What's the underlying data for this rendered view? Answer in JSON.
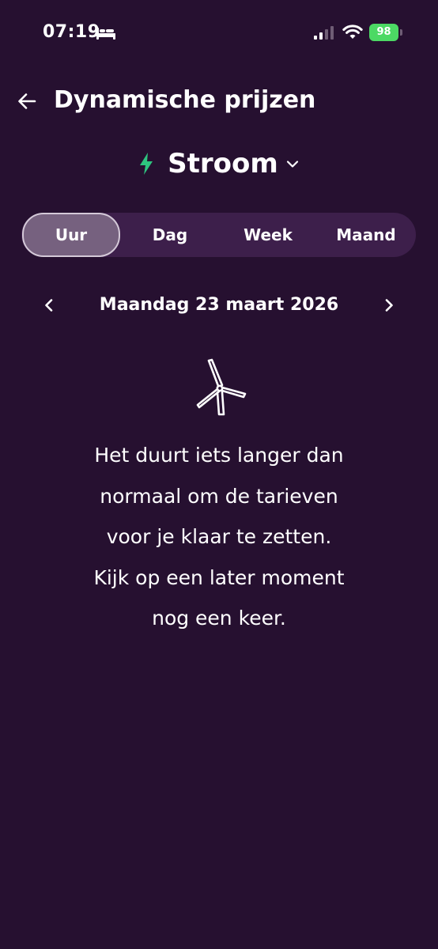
{
  "status_bar": {
    "time": "07:19",
    "battery": "98"
  },
  "header": {
    "title": "Dynamische prijzen"
  },
  "energy_selector": {
    "label": "Stroom"
  },
  "period_tabs": [
    {
      "label": "Uur",
      "active": true
    },
    {
      "label": "Dag",
      "active": false
    },
    {
      "label": "Week",
      "active": false
    },
    {
      "label": "Maand",
      "active": false
    }
  ],
  "date_nav": {
    "date": "Maandag 23 maart 2026"
  },
  "message": {
    "lines": [
      "Het duurt iets langer dan",
      "normaal om de tarieven",
      "voor je klaar te zetten.",
      "Kijk op een later moment",
      "nog een keer."
    ]
  },
  "colors": {
    "background": "#261030",
    "tab_track": "#3d1f4b",
    "tab_active": "#76617f",
    "bolt": "#2ec47f",
    "battery": "#4cd964"
  },
  "icons": {
    "back": "arrow-left-icon",
    "bolt": "lightning-bolt-icon",
    "chevron": "chevron-down-icon",
    "prev": "chevron-left-icon",
    "next": "chevron-right-icon",
    "illustration": "wind-turbine-icon"
  }
}
